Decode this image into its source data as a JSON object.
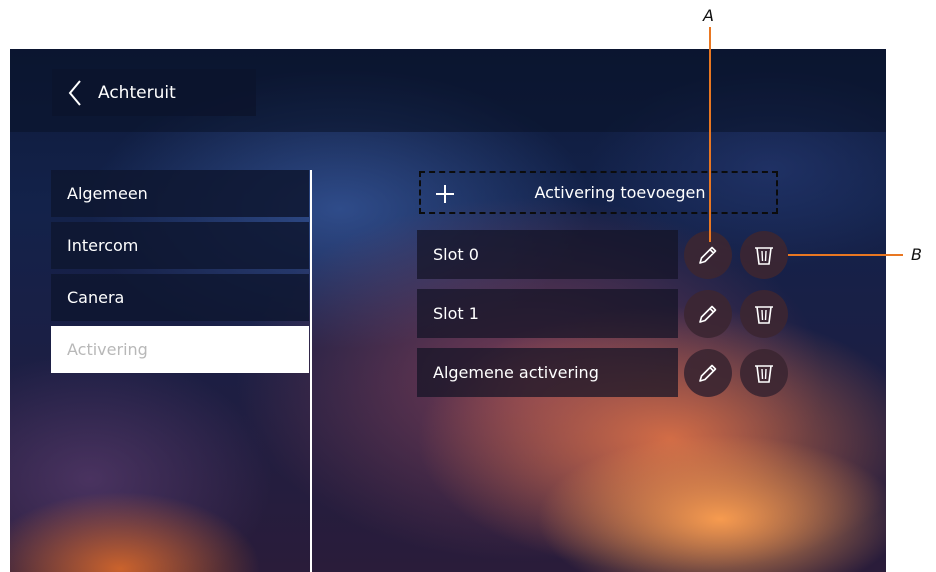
{
  "header": {
    "back_label": "Achteruit"
  },
  "sidebar": {
    "items": [
      {
        "label": "Algemeen",
        "selected": false
      },
      {
        "label": "Intercom",
        "selected": false
      },
      {
        "label": "Canera",
        "selected": false
      },
      {
        "label": "Activering",
        "selected": true
      }
    ]
  },
  "main": {
    "add_label": "Activering toevoegen",
    "rows": [
      {
        "label": "Slot 0"
      },
      {
        "label": "Slot 1"
      },
      {
        "label": "Algemene activering"
      }
    ]
  },
  "callouts": {
    "a": "A",
    "b": "B"
  },
  "colors": {
    "callout": "#e87722",
    "selected_bg": "#ffffff",
    "selected_text": "#b8b8b8"
  },
  "icons": {
    "back": "chevron-left-icon",
    "add": "plus-icon",
    "edit": "pencil-icon",
    "delete": "trash-icon"
  }
}
